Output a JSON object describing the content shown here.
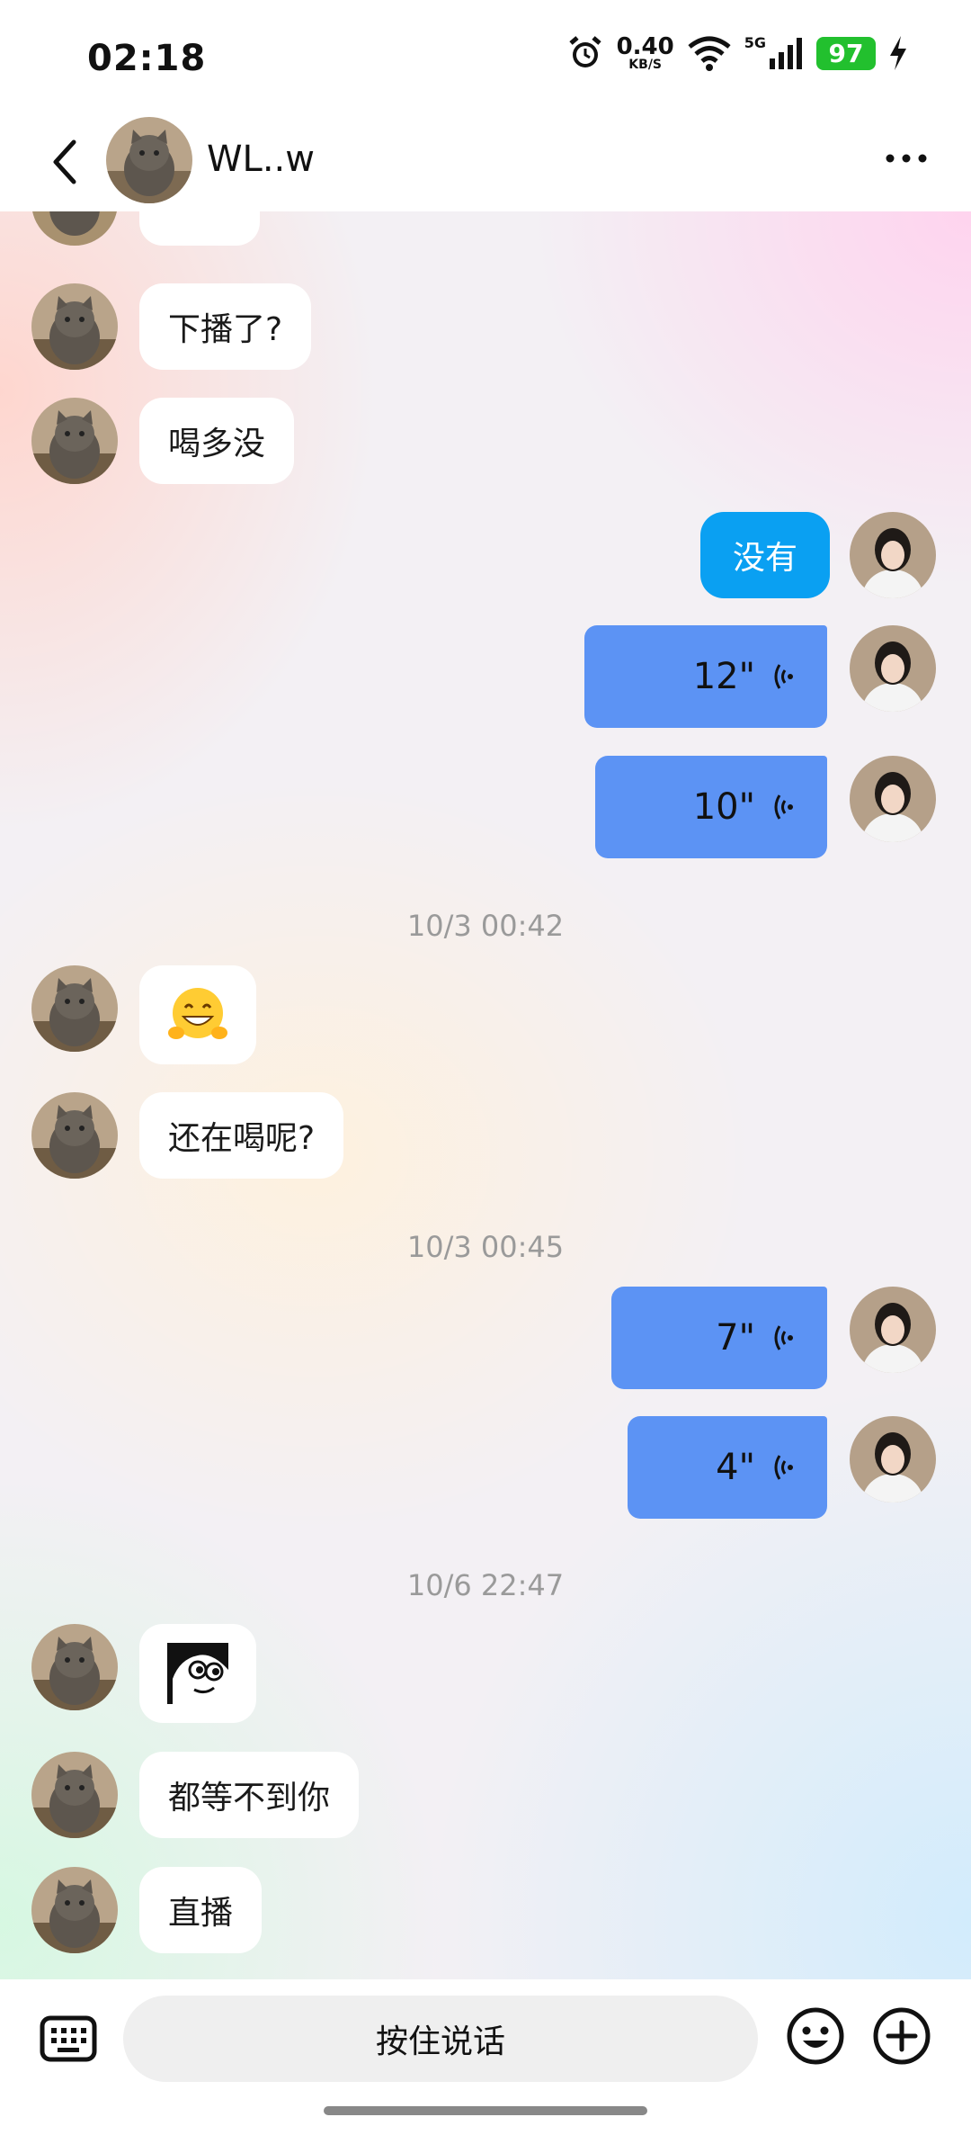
{
  "status_bar": {
    "time": "02:18",
    "net_speed_value": "0.40",
    "net_speed_unit": "KB/S",
    "network_label": "5G",
    "battery": "97",
    "icons": [
      "alarm-icon",
      "wifi-icon",
      "signal-icon",
      "battery-icon",
      "charging-icon"
    ]
  },
  "header": {
    "contact_name": "WL..w",
    "icons": [
      "back-icon",
      "more-icon"
    ]
  },
  "messages": {
    "m1": "下播了?",
    "m2": "喝多没",
    "m3": "没有",
    "v1": "12\"",
    "v2": "10\"",
    "ts1": "10/3 00:42",
    "m4_emoji": "grinning-hug-emoji",
    "m5": "还在喝呢?",
    "ts2": "10/3 00:45",
    "v3": "7\"",
    "v4": "4\"",
    "ts3": "10/6 22:47",
    "m6_sticker": "peeking-girl-sticker",
    "m7": "都等不到你",
    "m8": "直播"
  },
  "bottom_bar": {
    "hold_to_talk": "按住说话",
    "icons": [
      "keyboard-icon",
      "emoji-icon",
      "plus-icon"
    ]
  },
  "colors": {
    "my_text_bubble": "#0aa0f2",
    "voice_bubble": "#5c93f4",
    "battery_green": "#22c02e"
  }
}
